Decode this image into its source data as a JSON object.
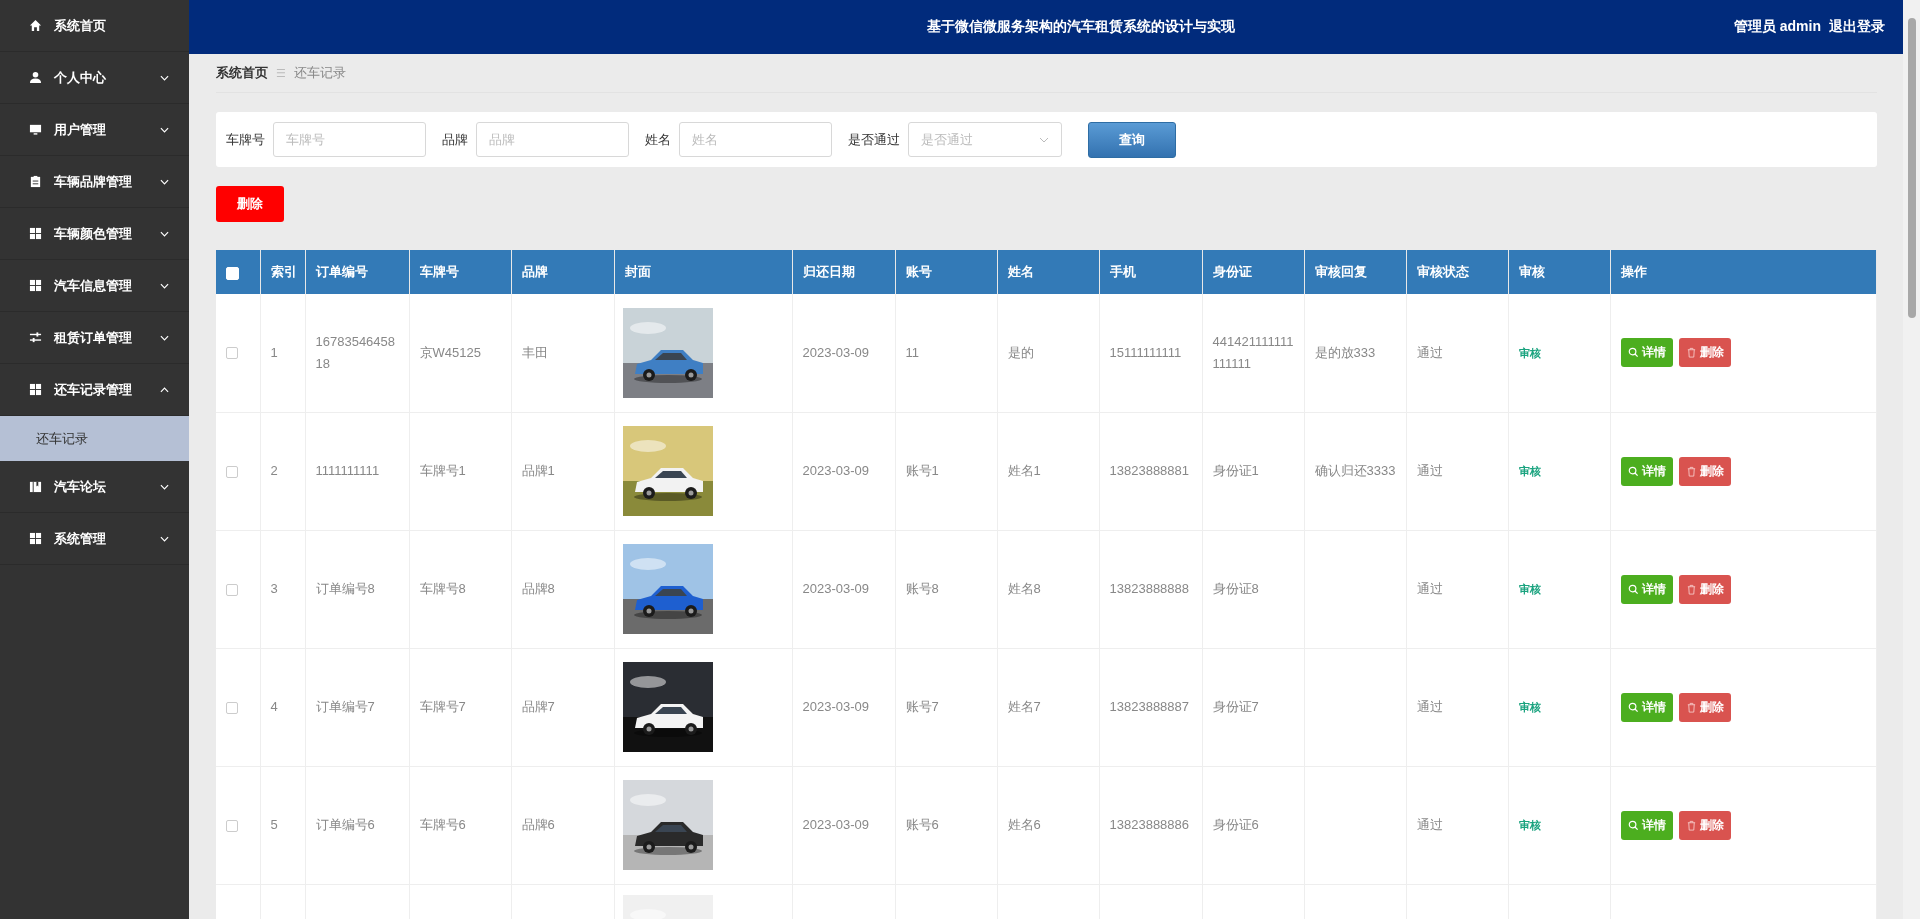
{
  "sidebar": {
    "items": [
      {
        "label": "系统首页",
        "kind": "link"
      },
      {
        "label": "个人中心",
        "kind": "menu",
        "expanded": false
      },
      {
        "label": "用户管理",
        "kind": "menu",
        "expanded": false
      },
      {
        "label": "车辆品牌管理",
        "kind": "menu",
        "expanded": false
      },
      {
        "label": "车辆颜色管理",
        "kind": "menu",
        "expanded": false
      },
      {
        "label": "汽车信息管理",
        "kind": "menu",
        "expanded": false
      },
      {
        "label": "租赁订单管理",
        "kind": "menu",
        "expanded": false
      },
      {
        "label": "还车记录管理",
        "kind": "menu",
        "expanded": true,
        "children": [
          {
            "label": "还车记录",
            "selected": true
          }
        ]
      },
      {
        "label": "汽车论坛",
        "kind": "menu",
        "expanded": false
      },
      {
        "label": "系统管理",
        "kind": "menu",
        "expanded": false
      }
    ]
  },
  "header": {
    "title": "基于微信微服务架构的汽车租赁系统的设计与实现",
    "user": "管理员 admin",
    "logout": "退出登录"
  },
  "breadcrumb": {
    "home": "系统首页",
    "separator": "☰",
    "current": "还车记录"
  },
  "search": {
    "fields": [
      {
        "label": "车牌号",
        "kind": "input",
        "placeholder": "车牌号"
      },
      {
        "label": "品牌",
        "kind": "input",
        "placeholder": "品牌"
      },
      {
        "label": "姓名",
        "kind": "input",
        "placeholder": "姓名"
      },
      {
        "label": "是否通过",
        "kind": "select",
        "placeholder": "是否通过"
      }
    ],
    "button": "查询"
  },
  "delete_button": "删除",
  "table": {
    "select_all": {
      "checked": false
    },
    "columns": [
      "索引",
      "订单编号",
      "车牌号",
      "品牌",
      "封面",
      "归还日期",
      "账号",
      "姓名",
      "手机",
      "身份证",
      "审核回复",
      "审核状态",
      "审核",
      "操作"
    ],
    "rows": [
      {
        "checked": false,
        "index": "1",
        "order_no": "1678354645818",
        "plate": "京W45125",
        "brand": "丰田",
        "return_date": "2023-03-09",
        "account": "11",
        "name": "是的",
        "phone": "15111111111",
        "id_card": "441421111111111111",
        "reply": "是的放333",
        "status": "通过",
        "audit": "审核",
        "actions": [
          {
            "kind": "detail",
            "label": "详情"
          },
          {
            "kind": "delete",
            "label": "删除"
          }
        ]
      },
      {
        "checked": false,
        "index": "2",
        "order_no": "1111111111",
        "plate": "车牌号1",
        "brand": "品牌1",
        "return_date": "2023-03-09",
        "account": "账号1",
        "name": "姓名1",
        "phone": "13823888881",
        "id_card": "身份证1",
        "reply": "确认归还3333",
        "status": "通过",
        "audit": "审核",
        "actions": [
          {
            "kind": "detail",
            "label": "详情"
          },
          {
            "kind": "delete",
            "label": "删除"
          }
        ]
      },
      {
        "checked": false,
        "index": "3",
        "order_no": "订单编号8",
        "plate": "车牌号8",
        "brand": "品牌8",
        "return_date": "2023-03-09",
        "account": "账号8",
        "name": "姓名8",
        "phone": "13823888888",
        "id_card": "身份证8",
        "status": "通过",
        "audit": "审核",
        "actions": [
          {
            "kind": "detail",
            "label": "详情"
          },
          {
            "kind": "delete",
            "label": "删除"
          }
        ]
      },
      {
        "checked": false,
        "index": "4",
        "order_no": "订单编号7",
        "plate": "车牌号7",
        "brand": "品牌7",
        "return_date": "2023-03-09",
        "account": "账号7",
        "name": "姓名7",
        "phone": "13823888887",
        "id_card": "身份证7",
        "status": "通过",
        "audit": "审核",
        "actions": [
          {
            "kind": "detail",
            "label": "详情"
          },
          {
            "kind": "delete",
            "label": "删除"
          }
        ]
      },
      {
        "checked": false,
        "index": "5",
        "order_no": "订单编号6",
        "plate": "车牌号6",
        "brand": "品牌6",
        "return_date": "2023-03-09",
        "account": "账号6",
        "name": "姓名6",
        "phone": "13823888886",
        "id_card": "身份证6",
        "status": "通过",
        "audit": "审核",
        "actions": [
          {
            "kind": "detail",
            "label": "详情"
          },
          {
            "kind": "delete",
            "label": "删除"
          }
        ]
      }
    ]
  }
}
